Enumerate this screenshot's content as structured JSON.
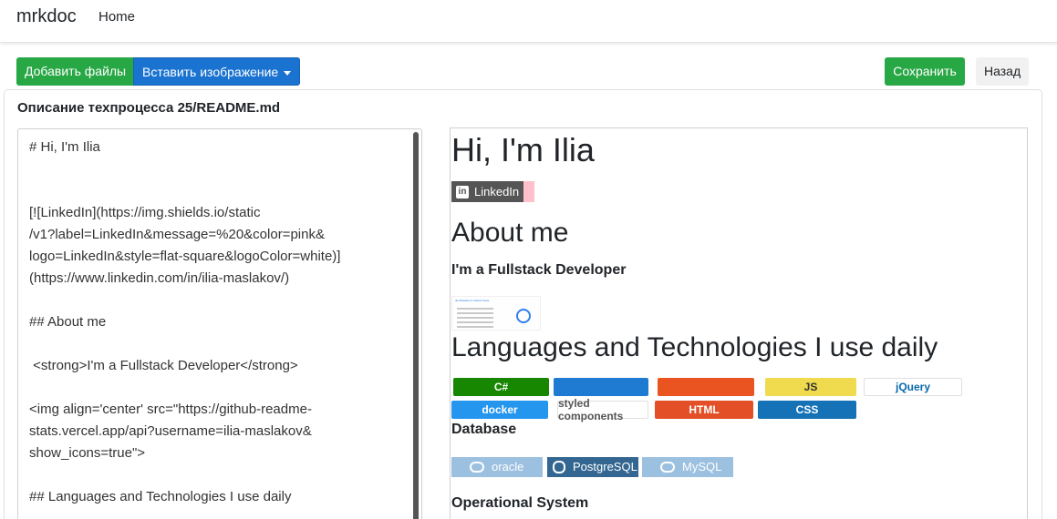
{
  "navbar": {
    "brand": "mrkdoc",
    "home": "Home"
  },
  "toolbar": {
    "add_files": "Добавить файлы",
    "insert_image": "Вставить изображение",
    "save": "Сохранить",
    "back": "Назад"
  },
  "card": {
    "title": "Описание техпроцесса 25/README.md"
  },
  "editor": {
    "lines": [
      "# Hi, I'm Ilia",
      "",
      "",
      "[![LinkedIn](https://img.shields.io/static",
      "/v1?label=LinkedIn&message=%20&color=pink&",
      "logo=LinkedIn&style=flat-square&logoColor=white)]",
      "(https://www.linkedin.com/in/ilia-maslakov/)",
      "",
      "## About me",
      "",
      " <strong>I'm a Fullstack Developer</strong>",
      "",
      "<img align='center' src=\"https://github-readme-",
      "stats.vercel.app/api?username=ilia-maslakov&",
      "show_icons=true\">",
      "",
      "## Languages and Technologies I use daily"
    ]
  },
  "preview": {
    "h1": "Hi, I'm Ilia",
    "linkedin_badge": {
      "label": "LinkedIn",
      "color": "#ffc0cb",
      "icon": "linkedin-icon"
    },
    "about_heading": "About me",
    "strong_text": "I'm a Fullstack Developer",
    "stats_title": "Ilia Maslakov's GitHub Stats",
    "languages_heading": "Languages and Technologies I use daily",
    "tech_badges": [
      {
        "label": "C#",
        "bg": "#178600",
        "fg": "#ffffff"
      },
      {
        "label": "",
        "icon": "visual-studio-icon",
        "bg": "#1f7ad1",
        "fg": "#ffffff"
      },
      {
        "label": "",
        "icon": "ubuntu-icon",
        "bg": "#e95420",
        "fg": "#ffffff"
      },
      {
        "label": "JS",
        "bg": "#f0db4f",
        "fg": "#323330"
      },
      {
        "label": "jQuery",
        "bg": "#ffffff",
        "fg": "#0769ad"
      },
      {
        "label": "docker",
        "bg": "#2496ed",
        "fg": "#ffffff"
      },
      {
        "label": "styled components",
        "bg": "#ffffff",
        "fg": "#555555"
      },
      {
        "label": "HTML",
        "bg": "#e34f26",
        "fg": "#ffffff"
      },
      {
        "label": "CSS",
        "bg": "#1572b6",
        "fg": "#ffffff"
      }
    ],
    "database_heading": "Database",
    "db_badges": [
      {
        "label": "oracle",
        "icon": "oracle-icon",
        "bg": "#9cc0e0"
      },
      {
        "label": "PostgreSQL",
        "icon": "postgresql-icon",
        "bg": "#336791"
      },
      {
        "label": "MySQL",
        "icon": "mysql-icon",
        "bg": "#9cc0e0"
      }
    ],
    "os_heading": "Operational System"
  }
}
